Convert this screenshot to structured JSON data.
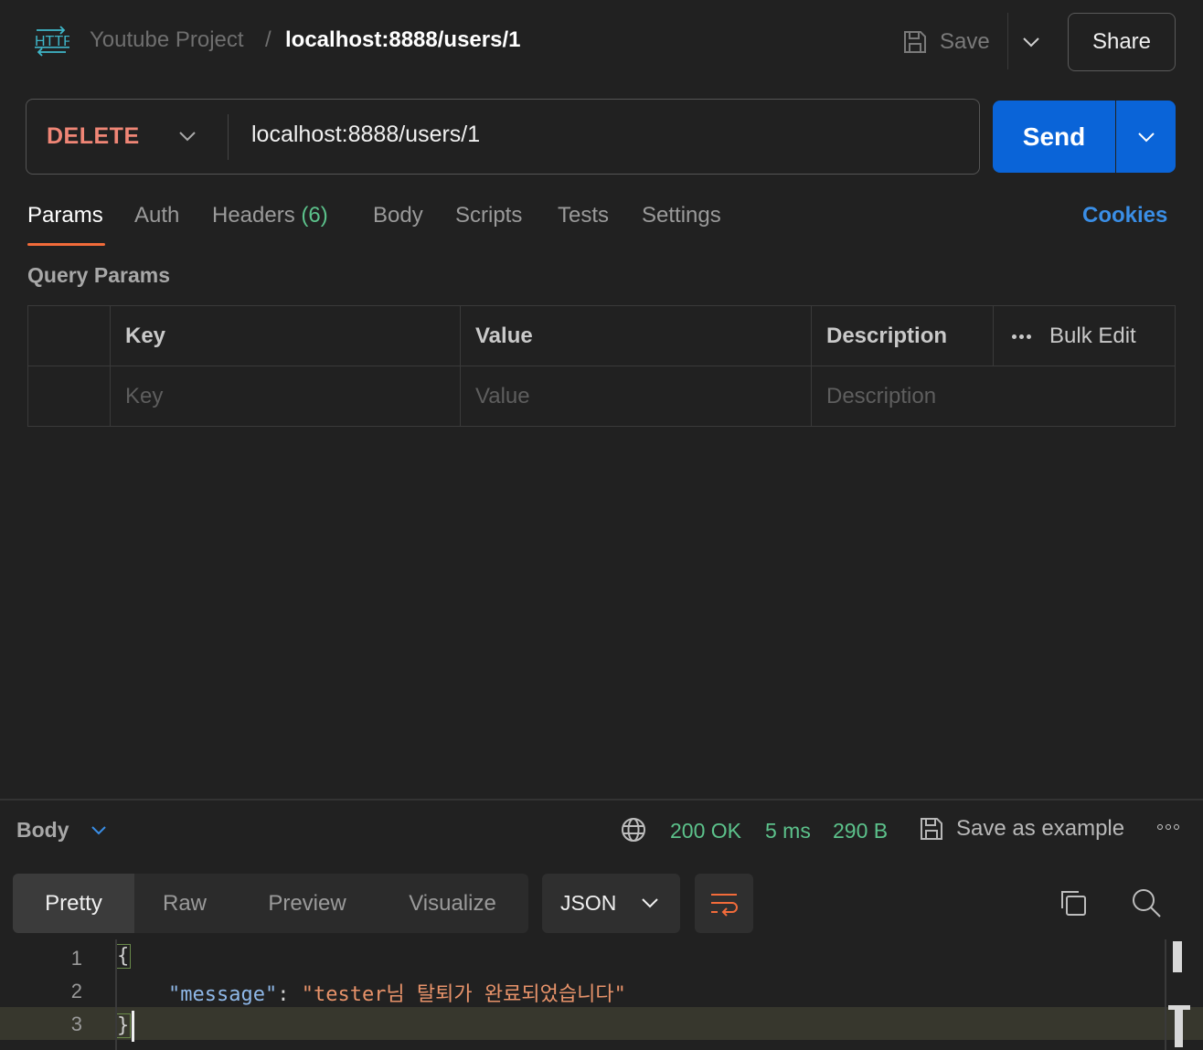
{
  "header": {
    "project": "Youtube Project",
    "separator": "/",
    "request_name": "localhost:8888/users/1",
    "save_label": "Save",
    "share_label": "Share"
  },
  "request": {
    "method": "DELETE",
    "url": "localhost:8888/users/1",
    "send_label": "Send"
  },
  "tabs": [
    {
      "label": "Params",
      "active": true
    },
    {
      "label": "Auth"
    },
    {
      "label": "Headers",
      "count": "(6)"
    },
    {
      "label": "Body"
    },
    {
      "label": "Scripts"
    },
    {
      "label": "Tests"
    },
    {
      "label": "Settings"
    }
  ],
  "cookies_label": "Cookies",
  "query_params": {
    "title": "Query Params",
    "columns": [
      "Key",
      "Value",
      "Description"
    ],
    "bulk_edit": "Bulk Edit",
    "placeholders": {
      "key": "Key",
      "value": "Value",
      "description": "Description"
    }
  },
  "response": {
    "section_label": "Body",
    "status": "200 OK",
    "time": "5 ms",
    "size": "290 B",
    "save_example_label": "Save as example",
    "view_tabs": [
      "Pretty",
      "Raw",
      "Preview",
      "Visualize"
    ],
    "format": "JSON",
    "code_lines": [
      {
        "num": "1",
        "text": "{"
      },
      {
        "num": "2",
        "key": "\"message\"",
        "colon": ": ",
        "value": "\"tester님 탈퇴가 완료되었습니다\""
      },
      {
        "num": "3",
        "text": "}"
      }
    ]
  },
  "colors": {
    "accent_blue": "#0a64d8",
    "method_delete": "#f08676",
    "status_green": "#5cc28b",
    "tab_underline": "#f26b3a"
  },
  "icons": [
    "http-icon",
    "save-icon",
    "chevron-down-icon",
    "globe-icon",
    "save-example-icon",
    "more-icon",
    "wrap-icon",
    "copy-icon",
    "search-icon"
  ]
}
